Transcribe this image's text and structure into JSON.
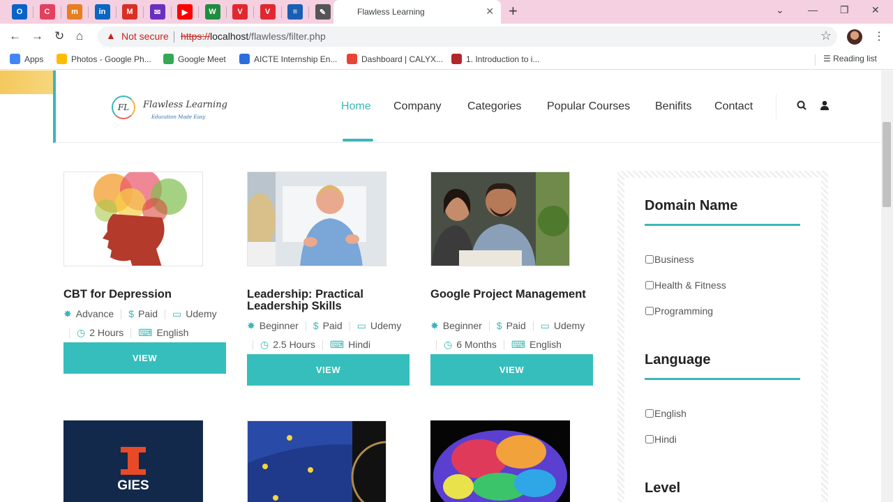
{
  "browser": {
    "active_tab_title": "Flawless Learning",
    "address": {
      "security_label": "Not secure",
      "scheme": "https://",
      "host": "localhost",
      "path": "/flawless/filter.php"
    },
    "bookmarks": [
      {
        "label": "Apps",
        "color": "#4285f4"
      },
      {
        "label": "Photos - Google Ph...",
        "color": "#fbbc04"
      },
      {
        "label": "Google Meet",
        "color": "#34a853"
      },
      {
        "label": "AICTE Internship En...",
        "color": "#2a6fdb"
      },
      {
        "label": "Dashboard | CALYX...",
        "color": "#ea4335"
      },
      {
        "label": "1. Introduction to i...",
        "color": "#b3262a"
      }
    ],
    "reading_list": "Reading list",
    "pinned_tabs": [
      {
        "icon": "outlook-icon",
        "glyph": "O",
        "color": "#0a64c8"
      },
      {
        "icon": "canva-icon",
        "glyph": "C",
        "color": "#e4405f"
      },
      {
        "icon": "m-icon",
        "glyph": "m",
        "color": "#e67e22"
      },
      {
        "icon": "linkedin-icon",
        "glyph": "in",
        "color": "#0a66c2"
      },
      {
        "icon": "gmail-icon",
        "glyph": "M",
        "color": "#d93025"
      },
      {
        "icon": "mail-icon",
        "glyph": "✉",
        "color": "#6b2fbf"
      },
      {
        "icon": "youtube-icon",
        "glyph": "▶",
        "color": "#ff0000"
      },
      {
        "icon": "w-icon",
        "glyph": "W",
        "color": "#1e8e3e"
      },
      {
        "icon": "v-icon",
        "glyph": "V",
        "color": "#e0282f"
      },
      {
        "icon": "v-icon",
        "glyph": "V",
        "color": "#e0282f"
      },
      {
        "icon": "doc-icon",
        "glyph": "≡",
        "color": "#1a5fb4"
      },
      {
        "icon": "pen-icon",
        "glyph": "✎",
        "color": "#555555"
      }
    ]
  },
  "site": {
    "logo_initials": "FL",
    "logo_name": "Flawless Learning",
    "tagline": "Education Made Easy",
    "nav": [
      "Home",
      "Company",
      "Categories",
      "Popular Courses",
      "Benifits",
      "Contact"
    ],
    "active_nav": "Home",
    "accent": "#3ab7b9"
  },
  "courses": [
    {
      "title": "CBT for Depression",
      "level": "Advance",
      "price": "Paid",
      "platform": "Udemy",
      "duration": "2 Hours",
      "language": "English",
      "button": "VIEW"
    },
    {
      "title": "Leadership: Practical Leadership Skills",
      "level": "Beginner",
      "price": "Paid",
      "platform": "Udemy",
      "duration": "2.5 Hours",
      "language": "Hindi",
      "button": "VIEW"
    },
    {
      "title": "Google Project Management",
      "level": "Beginner",
      "price": "Paid",
      "platform": "Udemy",
      "duration": "6 Months",
      "language": "English",
      "button": "VIEW"
    }
  ],
  "row2": {
    "gies_text": "GIES"
  },
  "filters": {
    "domain_heading": "Domain Name",
    "domains": [
      "Business",
      "Health & Fitness",
      "Programming"
    ],
    "language_heading": "Language",
    "languages": [
      "English",
      "Hindi"
    ],
    "level_heading": "Level"
  }
}
